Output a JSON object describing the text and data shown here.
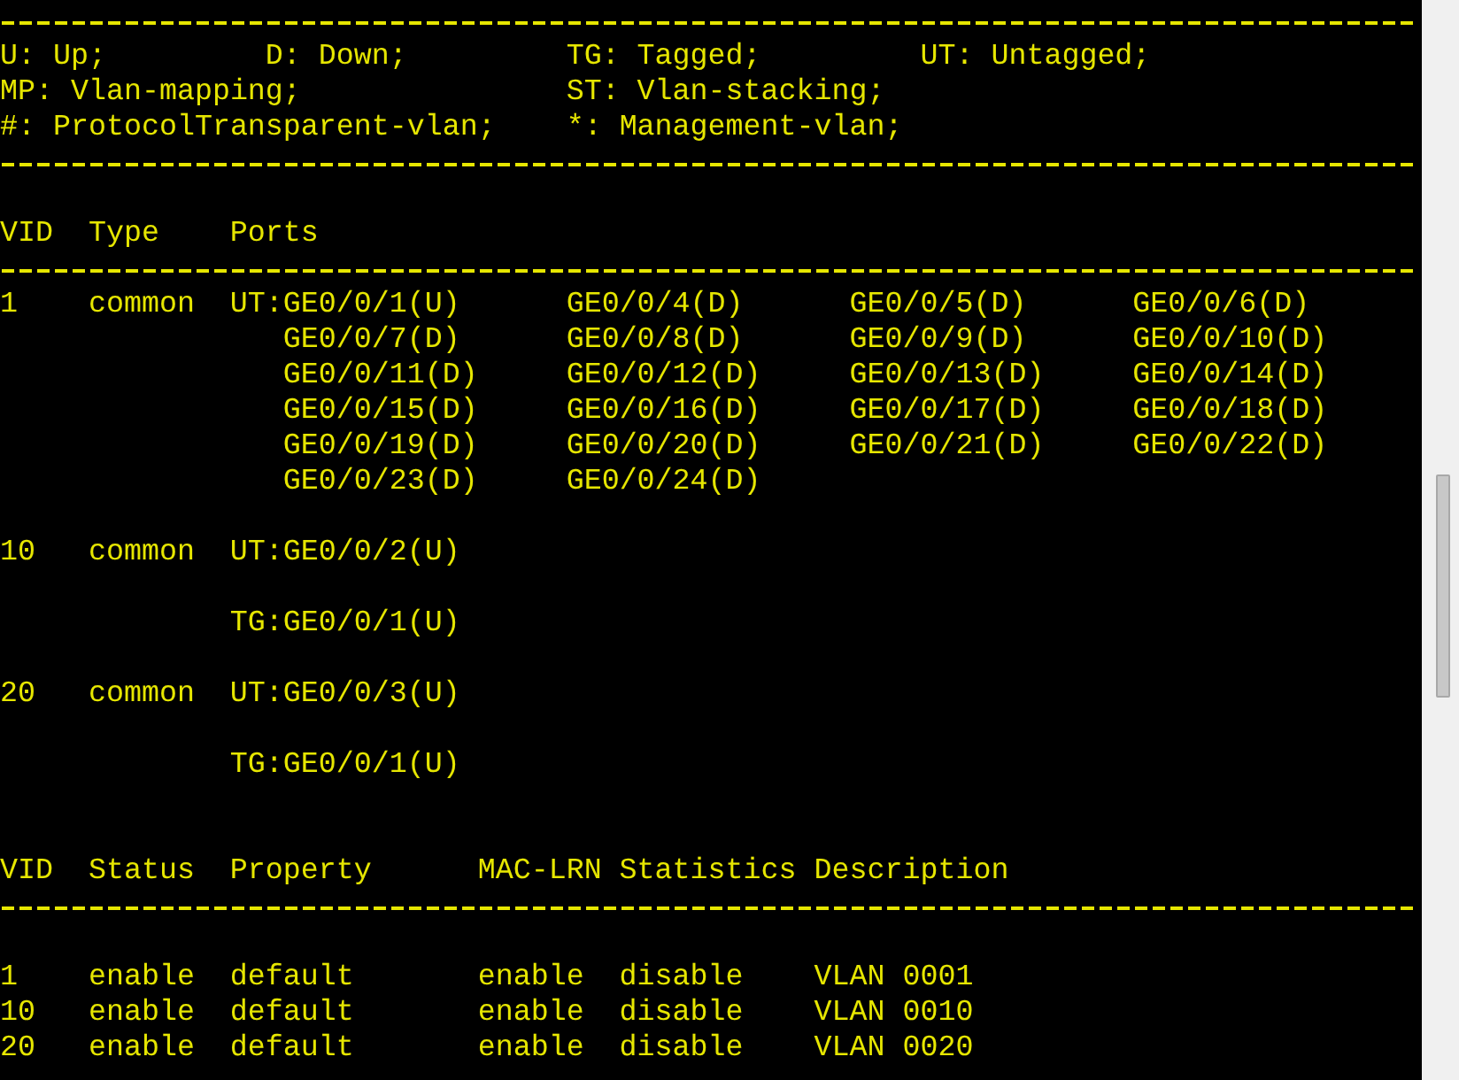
{
  "legend": [
    [
      "U: Up;",
      "D: Down;",
      "TG: Tagged;",
      "UT: Untagged;"
    ],
    [
      "MP: Vlan-mapping;",
      "ST: Vlan-stacking;"
    ],
    [
      "#: ProtocolTransparent-vlan;",
      "*: Management-vlan;"
    ]
  ],
  "vlan_table": {
    "columns": [
      "VID",
      "Type",
      "Ports"
    ],
    "rows": [
      {
        "vid": "1",
        "type": "common",
        "groups": [
          [
            "UT:GE0/0/1(U)",
            "GE0/0/4(D)",
            "GE0/0/5(D)",
            "GE0/0/6(D)",
            "GE0/0/7(D)",
            "GE0/0/8(D)",
            "GE0/0/9(D)",
            "GE0/0/10(D)",
            "GE0/0/11(D)",
            "GE0/0/12(D)",
            "GE0/0/13(D)",
            "GE0/0/14(D)",
            "GE0/0/15(D)",
            "GE0/0/16(D)",
            "GE0/0/17(D)",
            "GE0/0/18(D)",
            "GE0/0/19(D)",
            "GE0/0/20(D)",
            "GE0/0/21(D)",
            "GE0/0/22(D)",
            "GE0/0/23(D)",
            "GE0/0/24(D)"
          ]
        ]
      },
      {
        "vid": "10",
        "type": "common",
        "groups": [
          [
            "UT:GE0/0/2(U)"
          ],
          [
            "TG:GE0/0/1(U)"
          ]
        ]
      },
      {
        "vid": "20",
        "type": "common",
        "groups": [
          [
            "UT:GE0/0/3(U)"
          ],
          [
            "TG:GE0/0/1(U)"
          ]
        ]
      }
    ]
  },
  "status_table": {
    "columns": [
      "VID",
      "Status",
      "Property",
      "MAC-LRN",
      "Statistics",
      "Description"
    ],
    "rows": [
      [
        "1",
        "enable",
        "default",
        "enable",
        "disable",
        "VLAN 0001"
      ],
      [
        "10",
        "enable",
        "default",
        "enable",
        "disable",
        "VLAN 0010"
      ],
      [
        "20",
        "enable",
        "default",
        "enable",
        "disable",
        "VLAN 0020"
      ]
    ]
  }
}
